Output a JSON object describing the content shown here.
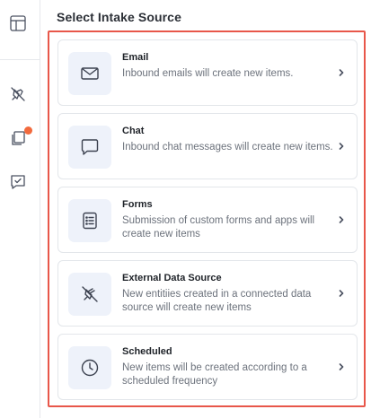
{
  "page": {
    "heading": "Select Intake Source"
  },
  "rail": {
    "icons": [
      "layout-icon",
      "no-pin-icon",
      "stack-icon",
      "checkbox-message-icon"
    ],
    "notification_color": "#f26a3d"
  },
  "sources": [
    {
      "title": "Email",
      "description": "Inbound emails will create new items.",
      "icon": "envelope-icon"
    },
    {
      "title": "Chat",
      "description": "Inbound chat messages will create new items.",
      "icon": "chat-bubble-icon"
    },
    {
      "title": "Forms",
      "description": "Submission of custom forms and apps will create new items",
      "icon": "form-list-icon"
    },
    {
      "title": "External Data Source",
      "description": "New entitiies created in a connected data source will create new items",
      "icon": "unplug-icon"
    },
    {
      "title": "Scheduled",
      "description": "New items will be created according to a scheduled frequency",
      "icon": "clock-icon"
    }
  ],
  "colors": {
    "highlight_frame": "#e8574a",
    "icon_tile": "#eef2fa",
    "icon_stroke": "#3c4250"
  }
}
